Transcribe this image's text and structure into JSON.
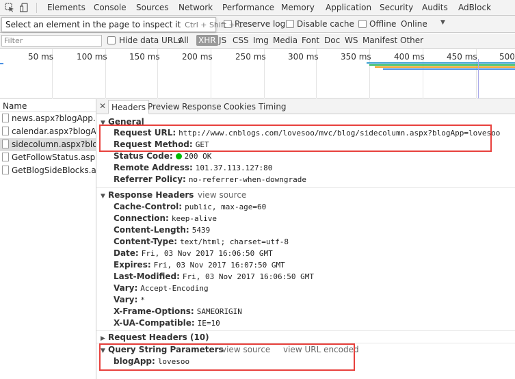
{
  "topbar": {
    "tabs": [
      "Elements",
      "Console",
      "Sources",
      "Network",
      "Performance",
      "Memory",
      "Application",
      "Security",
      "Audits",
      "AdBlock"
    ]
  },
  "toolbar": {
    "tooltip_text": "Select an element in the page to inspect it",
    "tooltip_shortcut": "Ctrl + Shift + C",
    "preserve_log": "Preserve log",
    "disable_cache": "Disable cache",
    "offline": "Offline",
    "throttle_value": "Online"
  },
  "filter": {
    "placeholder": "Filter",
    "hide_data_urls": "Hide data URLs",
    "types": [
      "All",
      "XHR",
      "JS",
      "CSS",
      "Img",
      "Media",
      "Font",
      "Doc",
      "WS",
      "Manifest",
      "Other"
    ],
    "active_type": "XHR"
  },
  "timeline": {
    "ticks": [
      "50 ms",
      "100 ms",
      "150 ms",
      "200 ms",
      "250 ms",
      "300 ms",
      "350 ms",
      "400 ms",
      "450 ms",
      "500"
    ]
  },
  "requests": {
    "header": "Name",
    "items": [
      "news.aspx?blogApp...",
      "calendar.aspx?blogA...",
      "sidecolumn.aspx?blo...",
      "GetFollowStatus.asp...",
      "GetBlogSideBlocks.a..."
    ],
    "selected_index": 2
  },
  "detail_tabs": [
    "Headers",
    "Preview",
    "Response",
    "Cookies",
    "Timing"
  ],
  "general": {
    "title": "General",
    "rows": [
      {
        "k": "Request URL:",
        "v": "http://www.cnblogs.com/lovesoo/mvc/blog/sidecolumn.aspx?blogApp=lovesoo"
      },
      {
        "k": "Request Method:",
        "v": "GET"
      },
      {
        "k": "Status Code:",
        "v": "200 OK"
      },
      {
        "k": "Remote Address:",
        "v": "101.37.113.127:80"
      },
      {
        "k": "Referrer Policy:",
        "v": "no-referrer-when-downgrade"
      }
    ]
  },
  "response_headers": {
    "title": "Response Headers",
    "link": "view source",
    "rows": [
      {
        "k": "Cache-Control:",
        "v": "public, max-age=60"
      },
      {
        "k": "Connection:",
        "v": "keep-alive"
      },
      {
        "k": "Content-Length:",
        "v": "5439"
      },
      {
        "k": "Content-Type:",
        "v": "text/html; charset=utf-8"
      },
      {
        "k": "Date:",
        "v": "Fri, 03 Nov 2017 16:06:50 GMT"
      },
      {
        "k": "Expires:",
        "v": "Fri, 03 Nov 2017 16:07:50 GMT"
      },
      {
        "k": "Last-Modified:",
        "v": "Fri, 03 Nov 2017 16:06:50 GMT"
      },
      {
        "k": "Vary:",
        "v": "Accept-Encoding"
      },
      {
        "k": "Vary:",
        "v": "*"
      },
      {
        "k": "X-Frame-Options:",
        "v": "SAMEORIGIN"
      },
      {
        "k": "X-UA-Compatible:",
        "v": "IE=10"
      }
    ]
  },
  "request_headers": {
    "title": "Request Headers (10)"
  },
  "query_params": {
    "title": "Query String Parameters",
    "link_source": "view source",
    "link_encoded": "view URL encoded",
    "rows": [
      {
        "k": "blogApp:",
        "v": "lovesoo"
      }
    ]
  },
  "colors": {
    "highlight_box": "#e8403c",
    "status_ok": "#00bb00",
    "active_filter": "#999999"
  }
}
